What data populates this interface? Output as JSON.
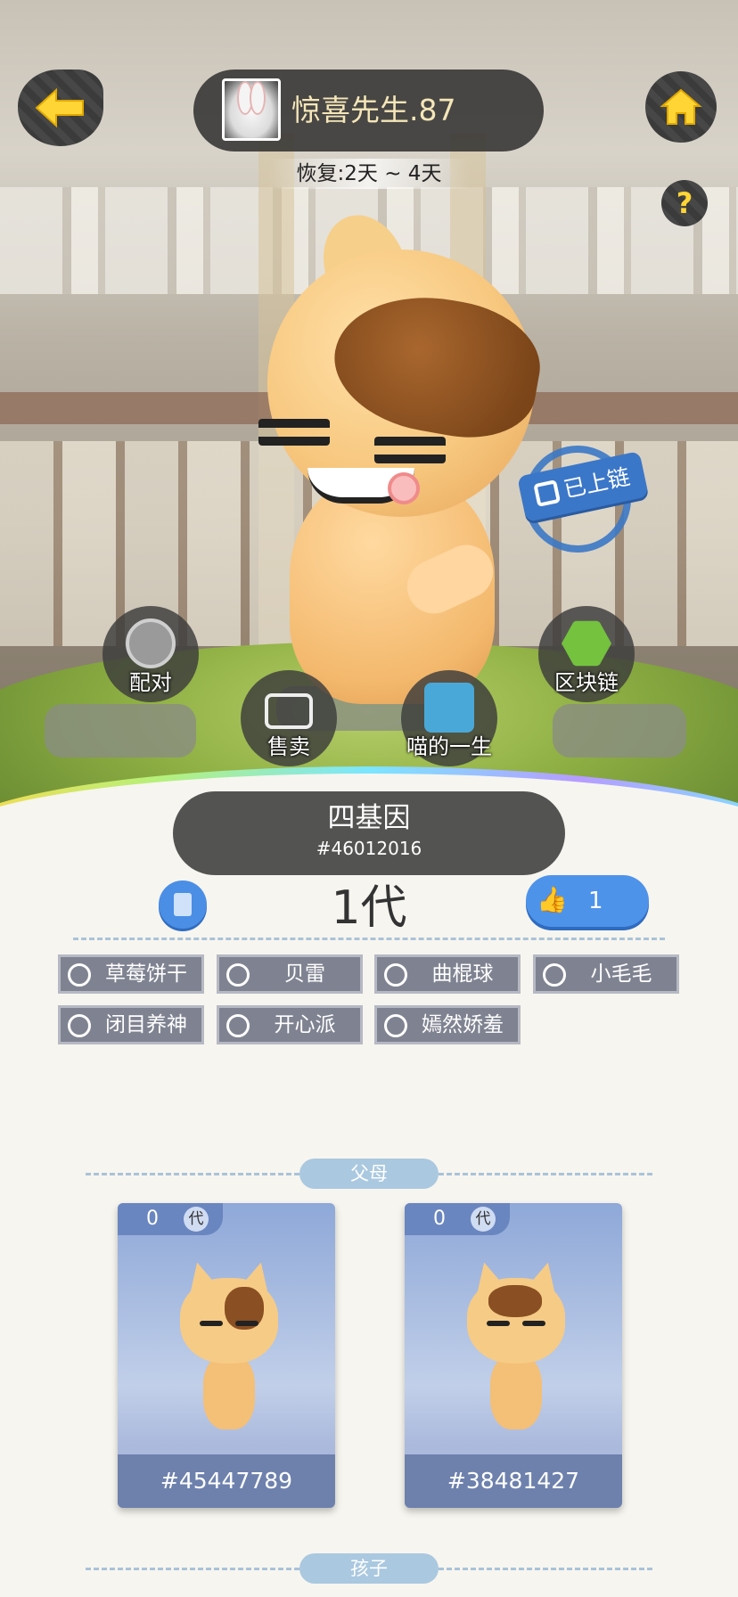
{
  "header": {
    "player_name": "惊喜先生.87",
    "recover_text": "恢复:2天 ~ 4天"
  },
  "icons": {
    "back": "arrow-left-icon",
    "home": "home-icon",
    "help": "question-icon"
  },
  "chain_badge": "已上链",
  "actions": {
    "pair": "配对",
    "sell": "售卖",
    "life": "喵的一生",
    "blockchain": "区块链"
  },
  "cat": {
    "name": "四基因",
    "id": "#46012016",
    "generation": "1代",
    "likes": "1"
  },
  "traits": [
    "草莓饼干",
    "贝雷",
    "曲棍球",
    "小毛毛",
    "闭目养神",
    "开心派",
    "嫣然娇羞"
  ],
  "sections": {
    "parents": "父母",
    "children": "孩子"
  },
  "parents": [
    {
      "gen_num": "0",
      "gen_char": "代",
      "id": "#45447789"
    },
    {
      "gen_num": "0",
      "gen_char": "代",
      "id": "#38481427"
    }
  ],
  "colors": {
    "accent_yellow": "#ffd535",
    "accent_blue": "#4e93ea",
    "chip_gray": "#7f8391",
    "section_blue": "#aac8e0"
  }
}
